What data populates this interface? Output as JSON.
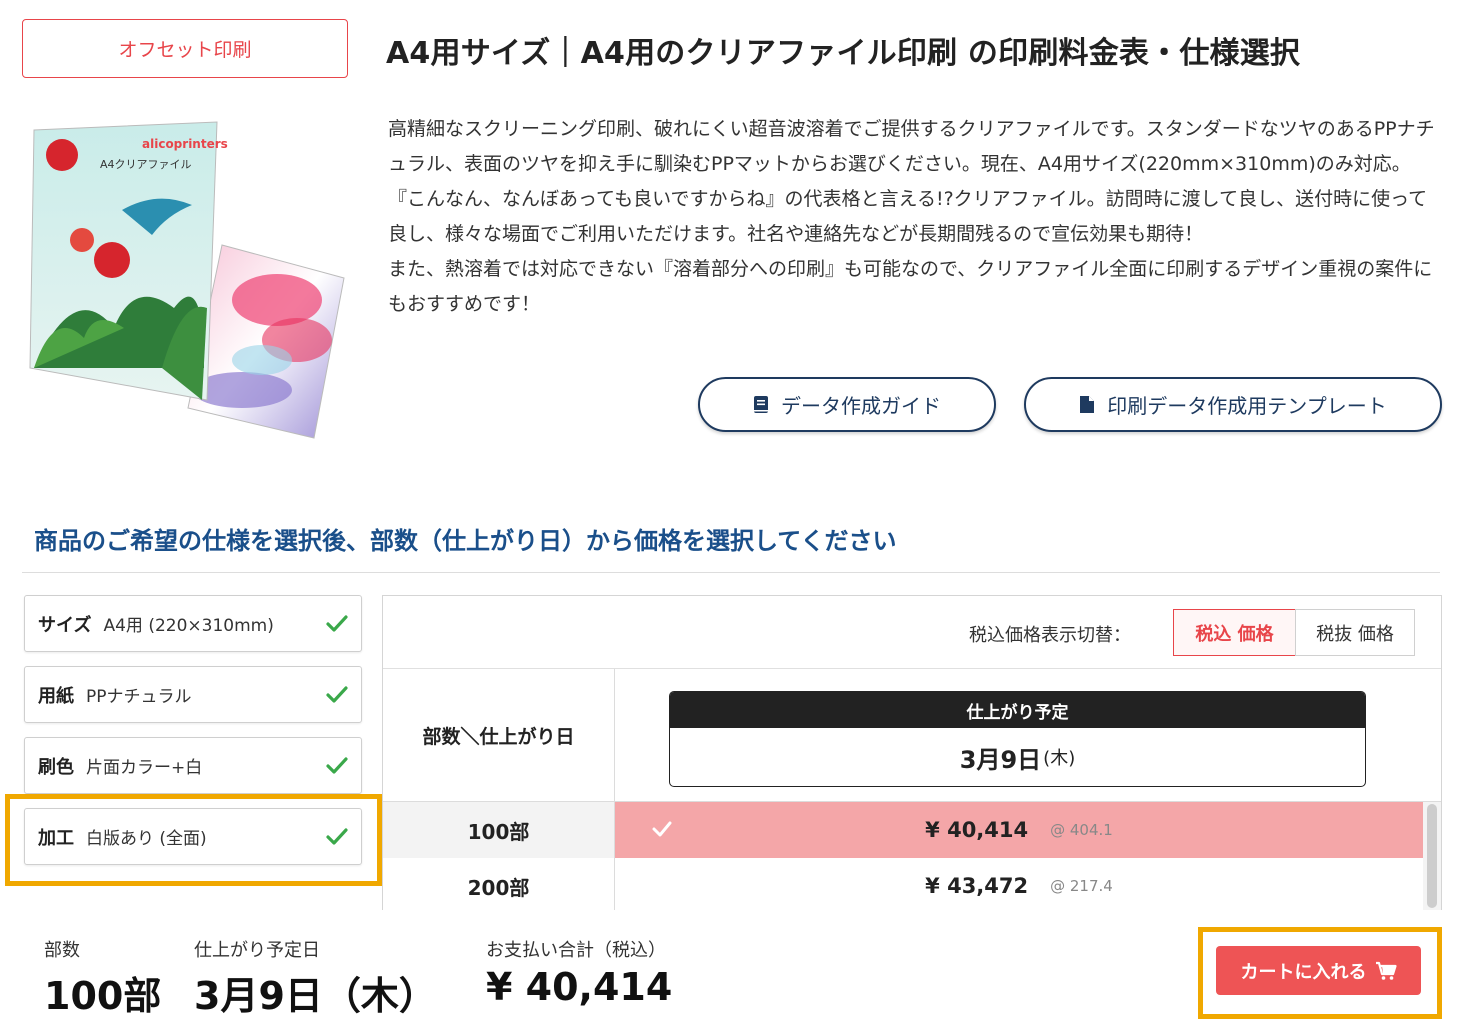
{
  "offset_tab": "オフセット印刷",
  "product_title": "A4用サイズ｜A4用のクリアファイル印刷 の印刷料金表・仕様選択",
  "description": [
    "高精細なスクリーニング印刷、破れにくい超音波溶着でご提供するクリアファイルです。スタンダードなツヤのあるPPナチュラル、表面のツヤを抑え手に馴染むPPマットからお選びください。現在、A4用サイズ(220mm×310mm)のみ対応。",
    "『こんなん、なんぼあっても良いですからね』の代表格と言える!?クリアファイル。訪問時に渡して良し、送付時に使って良し、様々な場面でご利用いただけます。社名や連絡先などが長期間残るので宣伝効果も期待！",
    "また、熱溶着では対応できない『溶着部分への印刷』も可能なので、クリアファイル全面に印刷するデザイン重視の案件にもおすすめです！"
  ],
  "image_text": {
    "brand": "alicoprinters",
    "label": "A4クリアファイル"
  },
  "buttons": {
    "data_guide": "データ作成ガイド",
    "template": "印刷データ作成用テンプレート"
  },
  "section_heading": "商品のご希望の仕様を選択後、部数（仕上がり日）から価格を選択してください",
  "specs": [
    {
      "label": "サイズ",
      "value": "A4用 (220×310mm)"
    },
    {
      "label": "用紙",
      "value": "PPナチュラル"
    },
    {
      "label": "刷色",
      "value": "片面カラー+白"
    },
    {
      "label": "加工",
      "value": "白版あり (全面)"
    }
  ],
  "price_toggle": {
    "label": "税込価格表示切替：",
    "tax_in": "税込 価格",
    "tax_out": "税抜 価格"
  },
  "table": {
    "qty_header": "部数＼仕上がり日",
    "date_header": "仕上がり予定",
    "date_value": "3月9日",
    "date_weekday": "(木)",
    "rows": [
      {
        "qty": "100部",
        "price": "¥ 40,414",
        "unit": "@ 404.1",
        "selected": true
      },
      {
        "qty": "200部",
        "price": "¥ 43,472",
        "unit": "@ 217.4",
        "selected": false
      }
    ]
  },
  "summary": {
    "qty_label": "部数",
    "qty_value": "100部",
    "date_label": "仕上がり予定日",
    "date_value": "3月9日（木）",
    "total_label": "お支払い合計（税込）",
    "total_value": "¥ 40,414"
  },
  "cart_button": "カートに入れる",
  "colors": {
    "accent_red": "#e8454a",
    "heading_blue": "#1a4f8a",
    "navy": "#1e3a5f",
    "check_green": "#3aa84a",
    "highlight": "#f0a800",
    "selected_row": "#f4a6a8"
  }
}
